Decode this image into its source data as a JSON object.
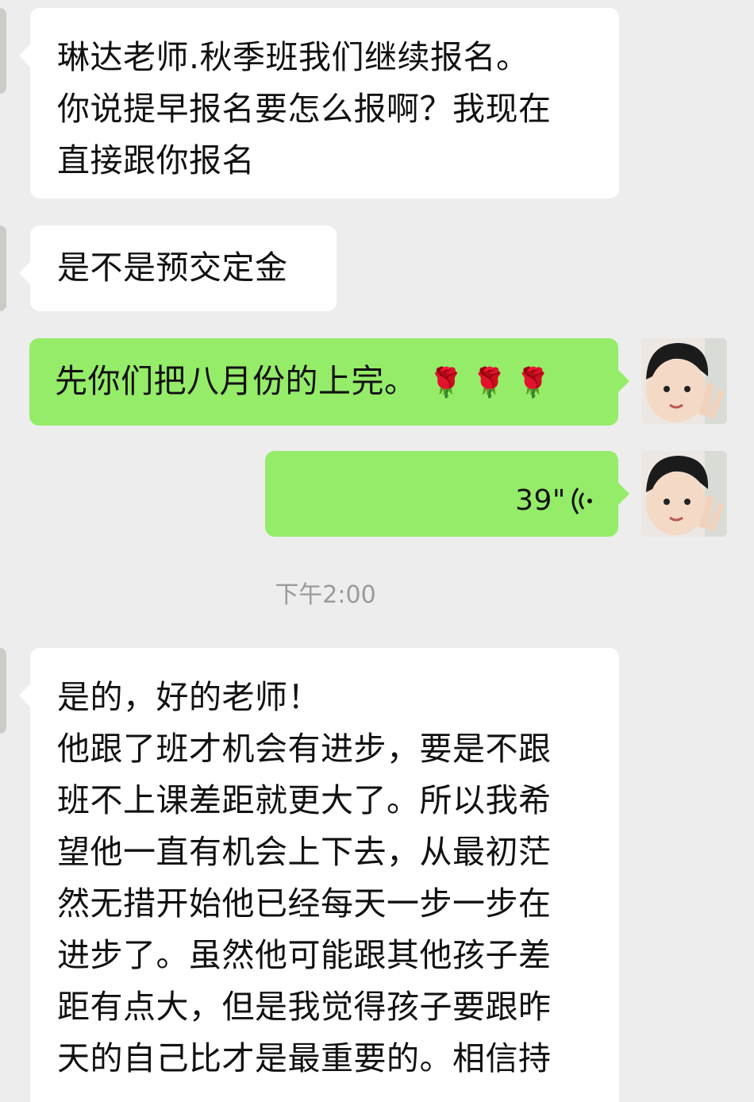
{
  "messages": {
    "m1": {
      "text": "琳达老师.秋季班我们继续报名。\n你说提早报名要怎么报啊？我现在\n直接跟你报名"
    },
    "m2": {
      "text": "是不是预交定金"
    },
    "m3": {
      "text": "先你们把八月份的上完。",
      "emoji": [
        "🌹",
        "🌹",
        "🌹"
      ]
    },
    "m4": {
      "voice_duration": "39\""
    },
    "m5": {
      "text": "是的，好的老师！\n他跟了班才机会有进步，要是不跟\n班不上课差距就更大了。所以我希\n望他一直有机会上下去，从最初茫\n然无措开始他已经每天一步一步在\n进步了。虽然他可能跟其他孩子差\n距有点大，但是我觉得孩子要跟昨\n天的自己比才是最重要的。相信持"
    }
  },
  "timestamp": "下午2:00",
  "icons": {
    "avatar_left": "contact-avatar",
    "avatar_right": "user-avatar-peace-sign",
    "voice": "voice-wave-icon"
  },
  "colors": {
    "background": "#ededed",
    "incoming_bubble": "#ffffff",
    "outgoing_bubble": "#95ec69",
    "rose": "#d8261f",
    "timestamp": "#9a9a9a"
  }
}
